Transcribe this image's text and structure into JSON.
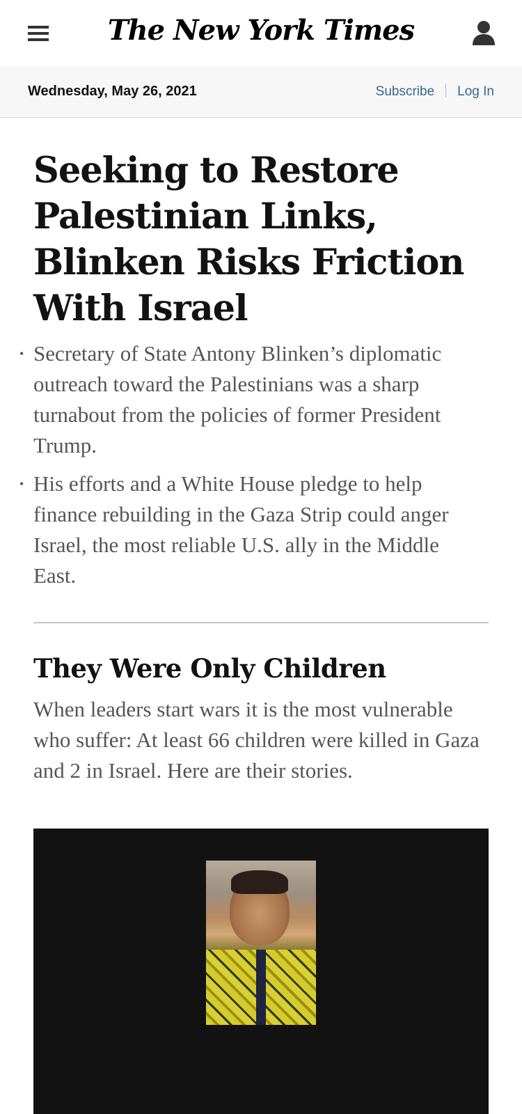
{
  "header": {
    "masthead": "The New York Times",
    "menu_icon": "hamburger-menu-icon",
    "account_icon": "user-account-icon"
  },
  "datebar": {
    "date": "Wednesday, May 26, 2021",
    "subscribe": "Subscribe",
    "login": "Log In"
  },
  "lead_story": {
    "headline": "Seeking to Restore Palestinian Links, Blinken Risks Friction With Israel",
    "bullets": [
      "Secretary of State Antony Blinken’s diplomatic outreach toward the Palestinians was a sharp turnabout from the policies of former President Trump.",
      "His efforts and a White House pledge to help finance rebuilding in the Gaza Strip could anger Israel, the most reliable U.S. ally in the Middle East."
    ]
  },
  "second_story": {
    "headline": "They Were Only Children",
    "summary": "When leaders start wars it is the most vulnerable who suffer: At least 66 children were killed in Gaza and 2 in Israel. Here are their stories."
  },
  "colors": {
    "link": "#326891",
    "media_bg": "#121212",
    "datebar_bg": "#f7f7f7"
  }
}
